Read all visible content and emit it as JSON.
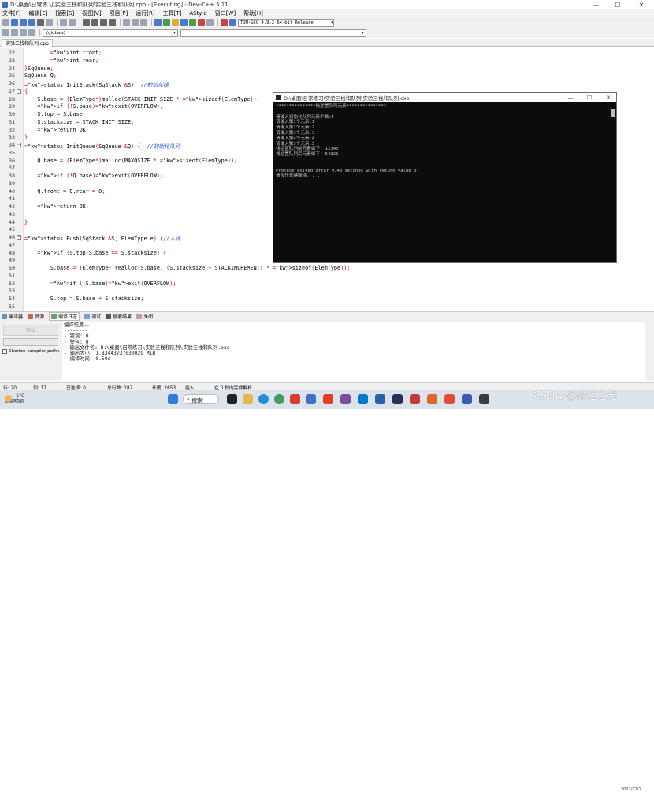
{
  "window": {
    "title": "D:\\桌面\\日常练习\\实验三栈和队列\\实验三栈和队列.cpp - [Executing] - Dev-C++ 5.11",
    "minimize": "—",
    "maximize": "☐",
    "close": "✕"
  },
  "menu": [
    "文件[F]",
    "编辑[E]",
    "搜索[S]",
    "视图[V]",
    "项目[P]",
    "运行[R]",
    "工具[T]",
    "AStyle",
    "窗口[W]",
    "帮助[H]"
  ],
  "toolbar": {
    "compiler": "TDM-GCC 4.9.2 64-bit Release",
    "scope": "(globals)"
  },
  "file_tab": "实验三栈和队列.cpp",
  "code_lines": [
    {
      "n": "22",
      "t": "        int front;"
    },
    {
      "n": "23",
      "t": "        int rear;"
    },
    {
      "n": "24",
      "t": "}SqQueue;"
    },
    {
      "n": "25",
      "t": "SqQueue Q;"
    },
    {
      "n": "26",
      "t": "status InitStack(SqStack &S)  //初始化栈"
    },
    {
      "n": "27",
      "t": "{"
    },
    {
      "n": "28",
      "t": "    S.base = (ElemType*)malloc(STACK_INIT_SIZE * sizeof(ElemType));"
    },
    {
      "n": "29",
      "t": "    if (!S.base)exit(OVERFLOW);"
    },
    {
      "n": "30",
      "t": "    S.top = S.base;"
    },
    {
      "n": "31",
      "t": "    S.stacksize = STACK_INIT_SIZE;"
    },
    {
      "n": "32",
      "t": "    return OK;"
    },
    {
      "n": "33",
      "t": "}"
    },
    {
      "n": "34",
      "t": "status InitQueue(SqQueue &Q) {  //初始化队列"
    },
    {
      "n": "35",
      "t": ""
    },
    {
      "n": "36",
      "t": "    Q.base = (ElemType*)malloc(MAXQSIZE * sizeof(ElemType));"
    },
    {
      "n": "37",
      "t": ""
    },
    {
      "n": "38",
      "t": "    if (!Q.base)exit(OVERFLOW);"
    },
    {
      "n": "39",
      "t": ""
    },
    {
      "n": "40",
      "t": "    Q.front = Q.rear = 0;"
    },
    {
      "n": "41",
      "t": ""
    },
    {
      "n": "42",
      "t": "    return OK;"
    },
    {
      "n": "43",
      "t": ""
    },
    {
      "n": "44",
      "t": "}"
    },
    {
      "n": "45",
      "t": ""
    },
    {
      "n": "46",
      "t": "status Push(SqStack &S, ElemType e) {//入栈"
    },
    {
      "n": "47",
      "t": ""
    },
    {
      "n": "48",
      "t": "    if (S.top-S.base == S.stacksize) {"
    },
    {
      "n": "49",
      "t": ""
    },
    {
      "n": "50",
      "t": "        S.base = (ElemType*)realloc(S.base, (S.stacksize + STACKINCREMENT) * sizeof(ElemType));"
    },
    {
      "n": "51",
      "t": ""
    },
    {
      "n": "52",
      "t": "        if (!S.base)exit(OVERFLOW);"
    },
    {
      "n": "53",
      "t": ""
    },
    {
      "n": "54",
      "t": "        S.top = S.base + S.stacksize;"
    },
    {
      "n": "55",
      "t": ""
    }
  ],
  "console": {
    "title": "D:\\桌面\\日常练习\\实验三栈和队列\\实验三栈和队列.exe",
    "lines": [
      "***************栈逆置队列元素***************",
      "",
      "请输入初始化队列元素个数:5",
      "请输入第1个元素:1",
      "请输入第2个元素:2",
      "请输入第3个元素:3",
      "请输入第4个元素:4",
      "请输入第5个元素:5",
      "栈逆置队列前元素如下: 12345",
      "栈逆置队列后元素如下: 54321",
      "",
      "--------------------------------",
      "Process exited after 9.48 seconds with return value 0",
      "请按任意键继续. . ."
    ]
  },
  "bottom_tabs": [
    "编译器",
    "资源",
    "编译日志",
    "调试",
    "搜索结果",
    "关闭"
  ],
  "bottom_panel": {
    "abort": "中止",
    "shorten": "Shorten compiler paths",
    "log": [
      "编译结果...",
      "--------",
      "- 错误: 0",
      "- 警告: 0",
      "- 输出文件名: D:\\桌面\\日常练习\\实验三栈和队列\\实验三栈和队列.exe",
      "- 输出大小: 1.83443737030029 MiB",
      "- 编译时间: 0.50s"
    ]
  },
  "status": {
    "row_label": "行:",
    "row": "20",
    "col_label": "列:",
    "col": "17",
    "sel_label": "已选择:",
    "sel": "0",
    "lines_label": "总行数:",
    "lines": "187",
    "len_label": "长度:",
    "len": "2653",
    "mode": "插入",
    "parse": "在 0 秒内完成解析"
  },
  "taskbar": {
    "temp": "-1°C",
    "weather": "局部晴朗",
    "search": "搜索",
    "watermark": "CSDN @命运之光",
    "clock": "2022/12/1"
  }
}
